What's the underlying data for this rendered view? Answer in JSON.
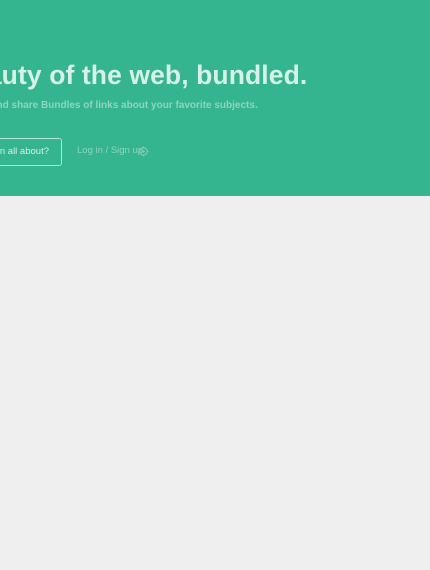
{
  "hero": {
    "headline": "eauty of the web, bundled.",
    "subline": "and share Bundles of links about your favorite subjects.",
    "cta_label": "dlin all about?",
    "auth_label": "Log in / Sign up",
    "auth_icon": "settings-icon"
  },
  "colors": {
    "hero_background": "#34b48f",
    "page_background": "#efefef",
    "headline_text": "#d6f1e7",
    "muted_text": "#8ed6bd"
  }
}
